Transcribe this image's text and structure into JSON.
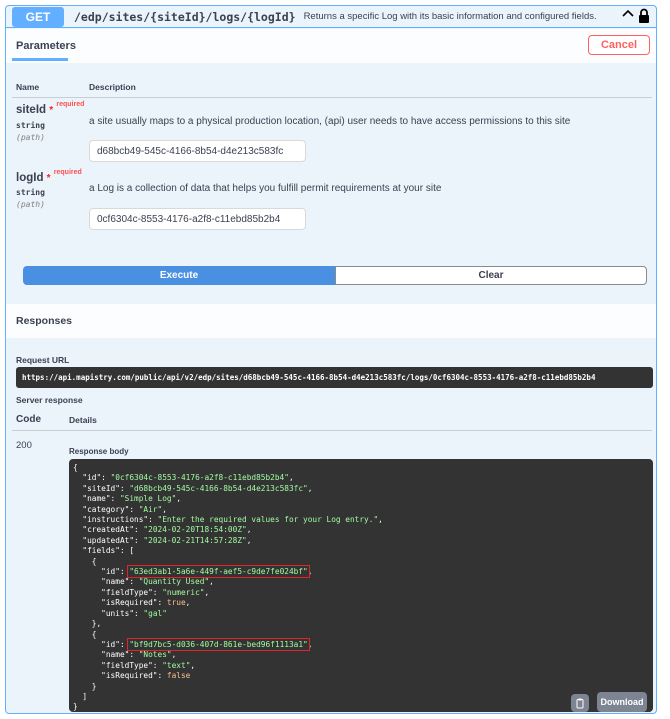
{
  "summary": {
    "method": "GET",
    "path": "/edp/sites/{siteId}/logs/{logId}",
    "description": "Returns a specific Log with its basic information and configured fields.",
    "chevron": "^"
  },
  "parameters": {
    "tab_label": "Parameters",
    "cancel_label": "Cancel",
    "col_name": "Name",
    "col_description": "Description",
    "required_label": "required",
    "items": [
      {
        "name": "siteId",
        "type": "string",
        "in": "(path)",
        "description": "a site usually maps to a physical production location, (api) user needs to have access permissions to this site",
        "value": "d68bcb49-545c-4166-8b54-d4e213c583fc"
      },
      {
        "name": "logId",
        "type": "string",
        "in": "(path)",
        "description": "a Log is a collection of data that helps you fulfill permit requirements at your site",
        "value": "0cf6304c-8553-4176-a2f8-c11ebd85b2b4"
      }
    ]
  },
  "actions": {
    "execute_label": "Execute",
    "clear_label": "Clear"
  },
  "responses": {
    "title": "Responses",
    "request_url_label": "Request URL",
    "request_url": "https://api.mapistry.com/public/api/v2/edp/sites/d68bcb49-545c-4166-8b54-d4e213c583fc/logs/0cf6304c-8553-4176-a2f8-c11ebd85b2b4",
    "server_response_label": "Server response",
    "col_code": "Code",
    "col_details": "Details",
    "code": "200",
    "body_label": "Response body",
    "download_label": "Download"
  },
  "response_body": {
    "id": "0cf6304c-8553-4176-a2f8-c11ebd85b2b4",
    "siteId": "d68bcb49-545c-4166-8b54-d4e213c583fc",
    "name": "Simple Log",
    "category": "Air",
    "instructions": "Enter the required values for your Log entry.",
    "createdAt": "2024-02-20T18:54:00Z",
    "updatedAt": "2024-02-21T14:57:28Z",
    "fields": [
      {
        "id": "63ed3ab1-5a6e-449f-aef5-c9de7fe024bf",
        "name": "Quantity Used",
        "fieldType": "numeric",
        "isRequired": "true",
        "units": "gal"
      },
      {
        "id": "bf9d7bc5-d036-407d-861e-bed96f1113a1",
        "name": "Notes",
        "fieldType": "text",
        "isRequired": "false"
      }
    ]
  },
  "colors": {
    "get_blue": "#61affe",
    "execute_blue": "#4990e2",
    "cancel_red": "#ff6060",
    "highlight_red": "#e0242a",
    "code_bg": "#333333",
    "string_green": "#a2fca2",
    "bool_orange": "#fcc28c"
  },
  "icons": {
    "lock": "lock-icon",
    "chevron": "chevron-up-icon",
    "copy": "copy-icon"
  }
}
